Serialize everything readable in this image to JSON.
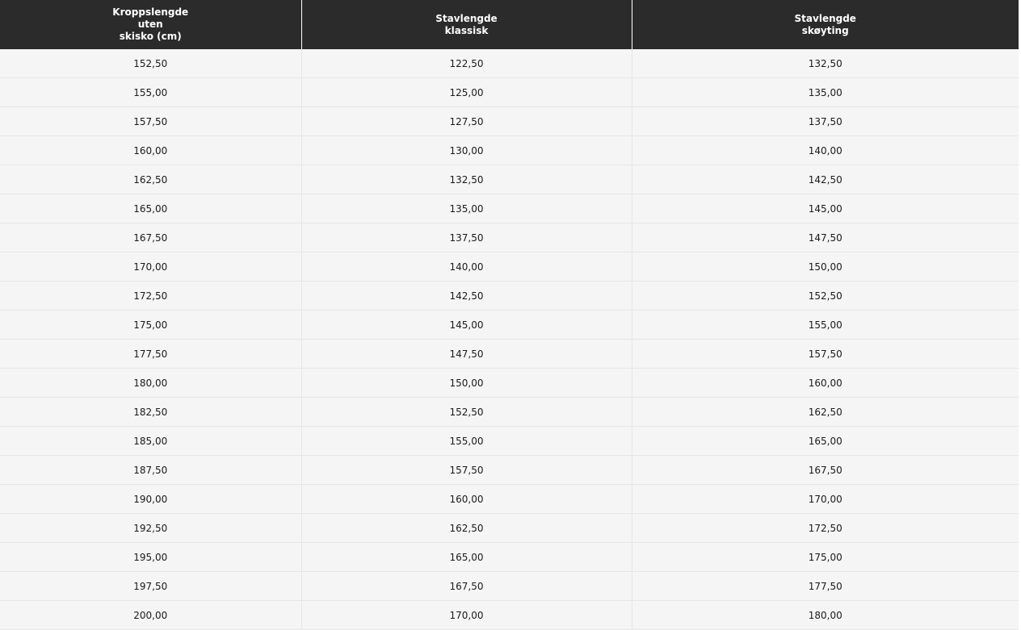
{
  "table": {
    "headers": [
      "Kroppslengde\nuten\nskisko (cm)",
      "Stavlengde\nklassisk",
      "Stavlengde\nskøyting"
    ],
    "rows": [
      [
        "152,50",
        "122,50",
        "132,50"
      ],
      [
        "155,00",
        "125,00",
        "135,00"
      ],
      [
        "157,50",
        "127,50",
        "137,50"
      ],
      [
        "160,00",
        "130,00",
        "140,00"
      ],
      [
        "162,50",
        "132,50",
        "142,50"
      ],
      [
        "165,00",
        "135,00",
        "145,00"
      ],
      [
        "167,50",
        "137,50",
        "147,50"
      ],
      [
        "170,00",
        "140,00",
        "150,00"
      ],
      [
        "172,50",
        "142,50",
        "152,50"
      ],
      [
        "175,00",
        "145,00",
        "155,00"
      ],
      [
        "177,50",
        "147,50",
        "157,50"
      ],
      [
        "180,00",
        "150,00",
        "160,00"
      ],
      [
        "182,50",
        "152,50",
        "162,50"
      ],
      [
        "185,00",
        "155,00",
        "165,00"
      ],
      [
        "187,50",
        "157,50",
        "167,50"
      ],
      [
        "190,00",
        "160,00",
        "170,00"
      ],
      [
        "192,50",
        "162,50",
        "172,50"
      ],
      [
        "195,00",
        "165,00",
        "175,00"
      ],
      [
        "197,50",
        "167,50",
        "177,50"
      ],
      [
        "200,00",
        "170,00",
        "180,00"
      ]
    ]
  },
  "colors": {
    "header_background": "#2b2b2b",
    "header_text": "#ffffff",
    "row_background": "#f5f5f5",
    "row_divider": "#e6e6e6",
    "cell_text": "#1a1a1a"
  }
}
